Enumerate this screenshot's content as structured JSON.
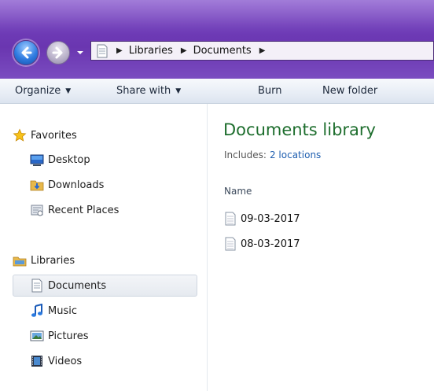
{
  "address": {
    "crumbs": [
      "Libraries",
      "Documents"
    ]
  },
  "toolbar": {
    "organize": "Organize",
    "share_with": "Share with",
    "burn": "Burn",
    "new_folder": "New folder"
  },
  "nav": {
    "favorites": {
      "label": "Favorites",
      "items": [
        {
          "label": "Desktop",
          "icon": "desktop-icon"
        },
        {
          "label": "Downloads",
          "icon": "downloads-folder-icon"
        },
        {
          "label": "Recent Places",
          "icon": "recent-places-icon"
        }
      ]
    },
    "libraries": {
      "label": "Libraries",
      "items": [
        {
          "label": "Documents",
          "icon": "document-icon",
          "selected": true
        },
        {
          "label": "Music",
          "icon": "music-note-icon"
        },
        {
          "label": "Pictures",
          "icon": "pictures-icon"
        },
        {
          "label": "Videos",
          "icon": "film-strip-icon"
        }
      ]
    }
  },
  "content": {
    "title": "Documents library",
    "includes_label": "Includes:",
    "includes_link": "2 locations",
    "column_name": "Name",
    "files": [
      {
        "name": "09-03-2017"
      },
      {
        "name": "08-03-2017"
      }
    ]
  },
  "colors": {
    "title_bar": "#6f3cb8",
    "library_title": "#1e6e2e",
    "link": "#1f5fb0"
  }
}
